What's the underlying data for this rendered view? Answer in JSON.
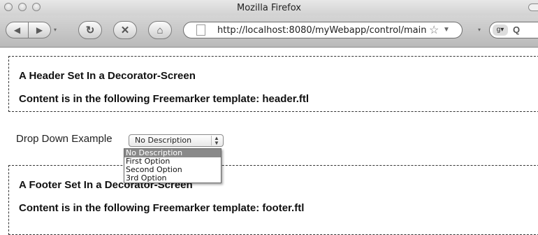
{
  "window": {
    "title": "Mozilla Firefox"
  },
  "toolbar": {
    "url": "http://localhost:8080/myWebapp/control/main"
  },
  "header_section": {
    "title": "A Header Set In a Decorator-Screen",
    "content": "Content is in the following Freemarker template: header.ftl"
  },
  "dropdown_example": {
    "label": "Drop Down Example",
    "selected": "No Description",
    "options": [
      "No Description",
      "First Option",
      "Second Option",
      "3rd Option"
    ]
  },
  "footer_section": {
    "title": "A Footer Set In a Decorator-Screen",
    "content": "Content is in the following Freemarker template: footer.ftl"
  },
  "icons": [
    "back-icon",
    "forward-icon",
    "reload-icon",
    "stop-icon",
    "home-icon",
    "page-icon",
    "bookmark-star-icon",
    "google-icon",
    "magnifier-icon"
  ]
}
